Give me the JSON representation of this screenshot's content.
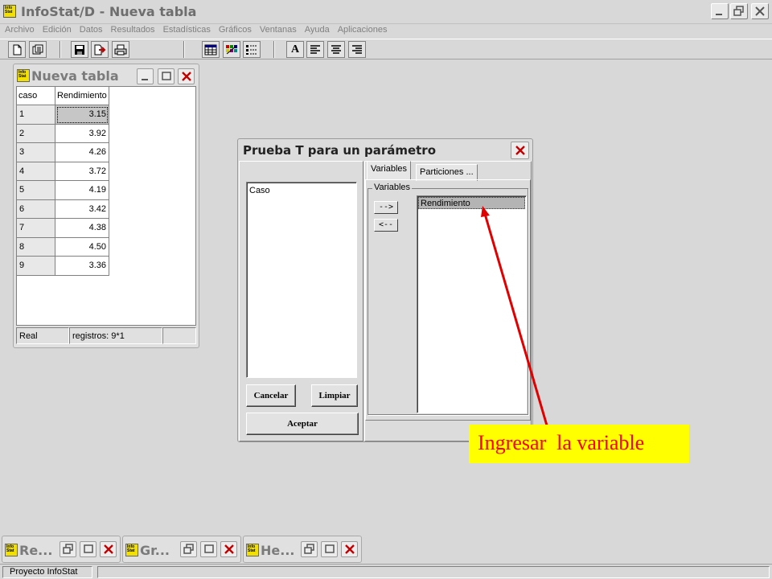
{
  "app": {
    "title": "InfoStat/D - Nueva tabla",
    "icon_text": "Info Stat"
  },
  "menu": [
    "Archivo",
    "Edición",
    "Datos",
    "Resultados",
    "Estadísticas",
    "Gráficos",
    "Ventanas",
    "Ayuda",
    "Aplicaciones"
  ],
  "toolbar": {
    "buttons": [
      "new-file-icon",
      "open-file-icon",
      "save-icon",
      "export-icon",
      "print-icon",
      "table-icon",
      "palette-icon",
      "list-icon",
      "bold-a-icon",
      "align-left-icon",
      "align-center-icon",
      "align-right-icon"
    ],
    "bold_label": "A"
  },
  "table_window": {
    "title": "Nueva tabla",
    "columns": [
      "caso",
      "Rendimiento"
    ],
    "rows": [
      {
        "caso": "1",
        "rendimiento": "3.15"
      },
      {
        "caso": "2",
        "rendimiento": "3.92"
      },
      {
        "caso": "3",
        "rendimiento": "4.26"
      },
      {
        "caso": "4",
        "rendimiento": "3.72"
      },
      {
        "caso": "5",
        "rendimiento": "4.19"
      },
      {
        "caso": "6",
        "rendimiento": "3.42"
      },
      {
        "caso": "7",
        "rendimiento": "4.38"
      },
      {
        "caso": "8",
        "rendimiento": "4.50"
      },
      {
        "caso": "9",
        "rendimiento": "3.36"
      }
    ],
    "status_type": "Real",
    "status_records": "registros: 9*1"
  },
  "dialog": {
    "title": "Prueba T para un parámetro",
    "source_list": [
      "Caso"
    ],
    "tabs": [
      "Variables",
      "Particiones ..."
    ],
    "group_label": "Variables",
    "add_arrow": "-->",
    "remove_arrow": "<--",
    "selected_variables": [
      "Rendimiento"
    ],
    "cancel_label": "Cancelar",
    "clear_label": "Limpiar",
    "accept_label": "Aceptar"
  },
  "callout": {
    "text": "Ingresar  la variable",
    "bg_color": "#ffff00",
    "text_color": "#ff0000",
    "arrow_color": "#e00000"
  },
  "minimized_windows": [
    "Re...",
    "Gr...",
    "He..."
  ],
  "statusbar": {
    "project": "Proyecto InfoStat"
  }
}
